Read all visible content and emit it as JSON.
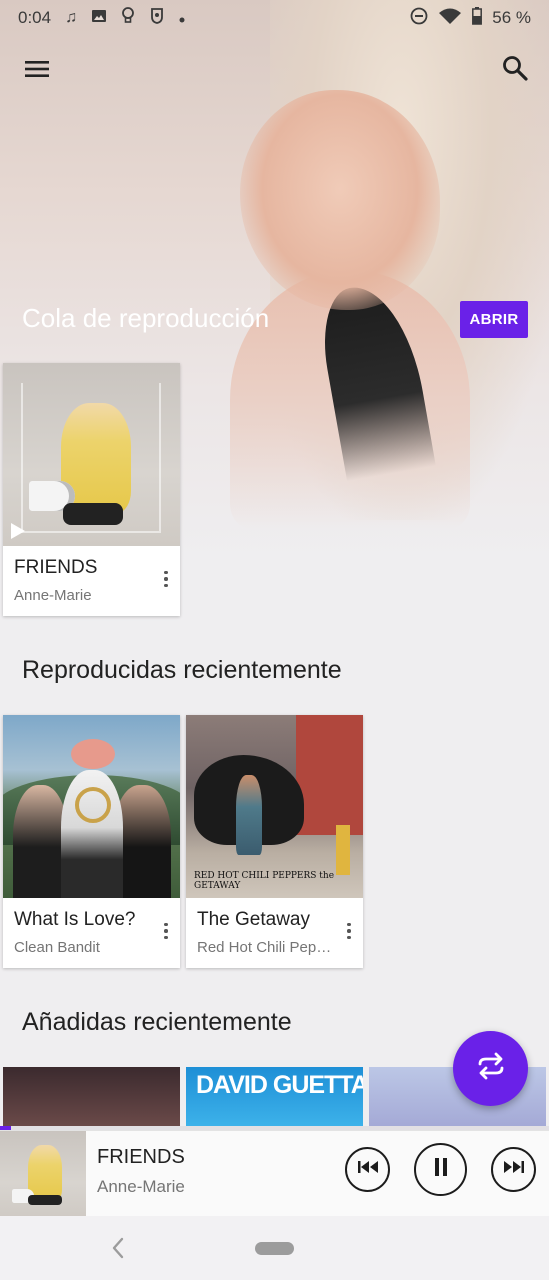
{
  "status_bar": {
    "time": "0:04",
    "battery": "56 %",
    "icons": [
      "music-note-icon",
      "image-icon",
      "lightbulb-icon",
      "shield-app-icon",
      "dot-icon",
      "do-not-disturb-icon",
      "wifi-icon",
      "battery-icon"
    ]
  },
  "top_bar": {
    "menu_icon": "hamburger-menu-icon",
    "search_icon": "search-icon"
  },
  "queue": {
    "title": "Cola de reproducción",
    "open_button": "ABRIR",
    "items": [
      {
        "title": "FRIENDS",
        "artist": "Anne-Marie"
      }
    ]
  },
  "recent": {
    "title": "Reproducidas recientemente",
    "items": [
      {
        "title": "What Is Love?",
        "artist": "Clean Bandit"
      },
      {
        "title": "The Getaway",
        "artist": "Red Hot Chili Peppers",
        "art_caption": "RED HOT CHILI PEPPERS the GETAWAY"
      }
    ]
  },
  "added": {
    "title": "Añadidas recientemente",
    "items": [
      {
        "art": "dark-portrait"
      },
      {
        "art": "david-guetta",
        "art_text": "DAVID GUETTA"
      },
      {
        "art": "pop-portrait"
      }
    ]
  },
  "fab": {
    "icon": "shuffle-play-icon"
  },
  "now_playing": {
    "title": "FRIENDS",
    "artist": "Anne-Marie",
    "progress": 0.02
  },
  "colors": {
    "accent": "#6a21e8",
    "background": "#efeef0",
    "card": "#ffffff",
    "primary_text": "#222222",
    "secondary_text": "#757575"
  }
}
